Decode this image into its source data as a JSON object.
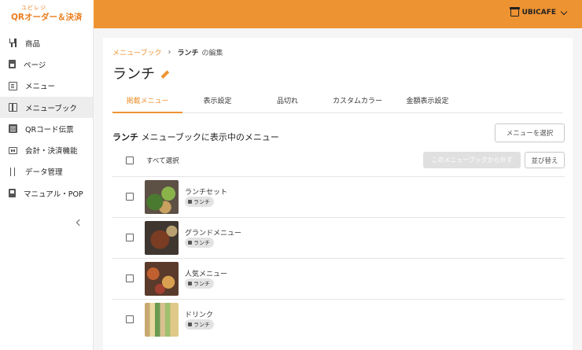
{
  "header": {
    "logo_small": "ユビレジ",
    "logo_main": "QRオーダー＆決済",
    "store_name": "UBICAFE"
  },
  "sidebar": {
    "items": [
      {
        "label": "商品",
        "icon": "utensils-icon"
      },
      {
        "label": "ページ",
        "icon": "document-icon"
      },
      {
        "label": "メニュー",
        "icon": "menu-icon"
      },
      {
        "label": "メニューブック",
        "icon": "book-icon"
      },
      {
        "label": "QRコード伝票",
        "icon": "list-icon"
      },
      {
        "label": "会計・決済機能",
        "icon": "payment-icon"
      },
      {
        "label": "データ管理",
        "icon": "sort-icon"
      },
      {
        "label": "マニュアル・POP",
        "icon": "manual-icon"
      }
    ]
  },
  "breadcrumb": {
    "parent": "メニューブック",
    "current_name": "ランチ",
    "current_suffix": "の編集"
  },
  "page": {
    "title": "ランチ"
  },
  "tabs": [
    "掲載メニュー",
    "表示設定",
    "品切れ",
    "カスタムカラー",
    "金額表示設定"
  ],
  "section": {
    "name": "ランチ",
    "suffix": "メニューブックに表示中のメニュー",
    "select_button": "メニューを選択",
    "remove_button": "このメニューブックから外す",
    "sort_button": "並び替え",
    "select_all": "すべて選択"
  },
  "menus": [
    {
      "name": "ランチセット",
      "tag": "ランチ"
    },
    {
      "name": "グランドメニュー",
      "tag": "ランチ"
    },
    {
      "name": "人気メニュー",
      "tag": "ランチ"
    },
    {
      "name": "ドリンク",
      "tag": "ランチ"
    }
  ],
  "colors": {
    "accent": "#ee9332"
  }
}
